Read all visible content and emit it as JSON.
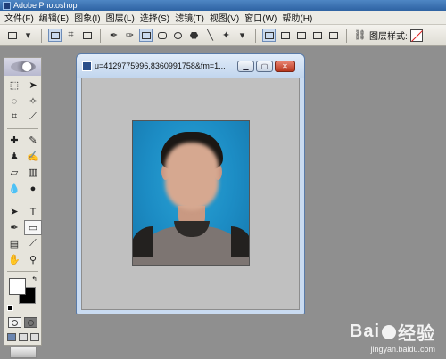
{
  "app": {
    "title": "Adobe Photoshop"
  },
  "menu": [
    "文件(F)",
    "编辑(E)",
    "图象(I)",
    "图层(L)",
    "选择(S)",
    "滤镜(T)",
    "视图(V)",
    "窗口(W)",
    "帮助(H)"
  ],
  "options_bar": {
    "layer_style_label": "图层样式:",
    "icons": [
      "rectangle-icon",
      "dropdown-icon",
      "shape-layers-icon",
      "paths-icon",
      "fill-pixels-icon",
      "pen-icon",
      "freeform-pen-icon",
      "rectangle-tool-icon",
      "rounded-rectangle-icon",
      "ellipse-icon",
      "polygon-icon",
      "line-icon",
      "custom-shape-icon",
      "combine-icons",
      "link-icon",
      "style-swatch-icon"
    ]
  },
  "document": {
    "title": "u=4129775996,8360991758&fm=1..."
  },
  "toolbox": {
    "tools": [
      "marquee-icon",
      "move-icon",
      "lasso-icon",
      "magic-wand-icon",
      "crop-icon",
      "slice-icon",
      "healing-brush-icon",
      "brush-icon",
      "clone-stamp-icon",
      "history-brush-icon",
      "eraser-icon",
      "gradient-icon",
      "blur-icon",
      "dodge-icon",
      "path-selection-icon",
      "type-icon",
      "pen-icon",
      "shape-icon",
      "notes-icon",
      "eyedropper-icon",
      "hand-icon",
      "zoom-icon"
    ],
    "foreground_color": "#ffffff",
    "background_color": "#000000"
  },
  "watermark": {
    "main": "Bai",
    "main_suffix": "经验",
    "sub": "jingyan.baidu.com"
  }
}
